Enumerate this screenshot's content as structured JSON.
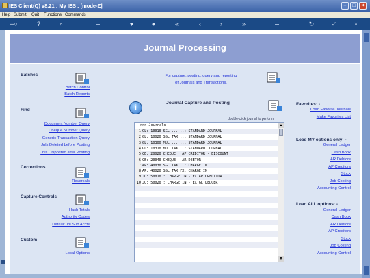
{
  "window": {
    "title": "IES Client(Q) v8.21 : My IES :       [mode-Z]",
    "buttons": {
      "minimize": "–",
      "maximize": "□",
      "close": "×"
    }
  },
  "menu": [
    "Help",
    "Submit",
    "Quit",
    "Functions",
    "Commands"
  ],
  "toolbar": {
    "icons": [
      "key-icon",
      "help-icon",
      "search-icon",
      "heart-icon",
      "circle-icon",
      "rewind-icon",
      "back-icon",
      "forward-icon",
      "fast-forward-icon",
      "refresh-icon",
      "check-icon",
      "close-icon"
    ],
    "glyphs": {
      "key": "─○",
      "help": "?",
      "search": "⌕",
      "heart": "♥",
      "circle": "●",
      "rewind": "«",
      "back": "‹",
      "forward": "›",
      "fastforward": "»",
      "refresh": "↻",
      "check": "✓",
      "close": "×"
    }
  },
  "banner": {
    "title": "Journal Processing"
  },
  "left": {
    "batches": {
      "heading": "Batches",
      "links": [
        "Batch Control",
        "Batch Reports"
      ]
    },
    "find": {
      "heading": "Find",
      "links": [
        "Document Number Query",
        "Cheque Number Query",
        "Generic Transaction Query",
        "Jnls Deleted before Posting",
        "Jnls UNposted after Posting"
      ]
    },
    "corrections": {
      "heading": "Corrections",
      "links": [
        "Reversals"
      ]
    },
    "capture_controls": {
      "heading": "Capture Controls",
      "links": [
        "Hash Totals",
        "Authority Codes",
        "Default Jnl Sub Accts"
      ]
    },
    "custom": {
      "heading": "Custom",
      "links": [
        "Local Options"
      ]
    }
  },
  "center": {
    "intro_line1": "For capture, posting, query and reporting",
    "intro_line2": "of Journals and Transactions.",
    "section_title": "Journal Capture and Posting",
    "hint": "double-click journal to perform",
    "info_glyph": "i",
    "list_header": ">>> Journals",
    "journals": [
      {
        "n": "1",
        "text": "GL: 10010 SGL ... ..: STANDARD JOURNAL"
      },
      {
        "n": "2",
        "text": "GL: 10020 SGL TAX ..: STANDARD JOURNAL"
      },
      {
        "n": "3",
        "text": "GL: 10300 MUL ... ..: STANDARD JOURNAL"
      },
      {
        "n": "4",
        "text": "GL: 10310 MUL TAX ..: STANDARD JOURNAL"
      },
      {
        "n": "5",
        "text": "CB: 20020 CHEQUE   : AP CREDITOR - DISCOUNT"
      },
      {
        "n": "6",
        "text": "CB: 20040 CHEQUE   : AR DEBTOR"
      },
      {
        "n": "7",
        "text": "AP: 40030 SGL TAX ..: CHARGE IN"
      },
      {
        "n": "8",
        "text": "AP: 40020 SGL TAX FX: CHARGE IN"
      },
      {
        "n": "9",
        "text": "JO: 50010 : CHARGE IN - EX AP CREDITOR"
      },
      {
        "n": "10",
        "text": "JO: 50020 : CHARGE IN - EX GL LEDGER"
      }
    ],
    "empty_rows": 12
  },
  "right": {
    "favorites": {
      "heading": "Favorites: -",
      "links": [
        "Load Favorite Journals",
        "Make Favorites List"
      ]
    },
    "load_my": {
      "heading": "Load MY options only: -",
      "links": [
        "General Ledger",
        "Cash Book",
        "AR Debtors",
        "AP Creditors",
        "Stock",
        "Job Costing",
        "Accounting Control"
      ]
    },
    "load_all": {
      "heading": "Load ALL options: -",
      "links": [
        "General Ledger",
        "Cash Book",
        "AR Debtors",
        "AP Creditors",
        "Stock",
        "Job Costing",
        "Accounting Control"
      ]
    }
  },
  "colors": {
    "titlebar": "#3b63a8",
    "toolbar": "#1b4a86",
    "banner": "#8d9ed1",
    "content": "#dce5f3",
    "link": "#1f2fd6"
  }
}
